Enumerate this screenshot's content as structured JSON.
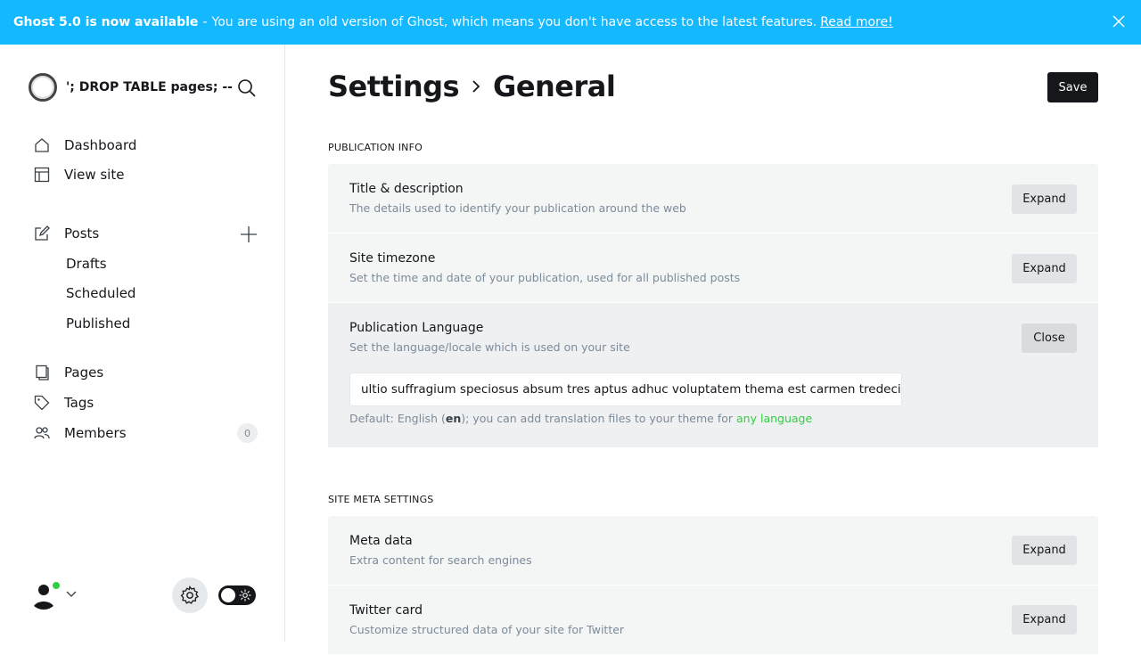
{
  "banner": {
    "bold": "Ghost 5.0 is now available",
    "separator": "-",
    "message": "You are using an old version of Ghost, which means you don't have access to the latest features.",
    "link": "Read more!"
  },
  "sidebar": {
    "site_name": "'; DROP TABLE pages; --",
    "nav": {
      "dashboard": "Dashboard",
      "view_site": "View site",
      "posts": "Posts",
      "drafts": "Drafts",
      "scheduled": "Scheduled",
      "published": "Published",
      "pages": "Pages",
      "tags": "Tags",
      "members": "Members",
      "members_count": "0"
    }
  },
  "main": {
    "breadcrumb": [
      "Settings",
      "General"
    ],
    "save_label": "Save",
    "sections": [
      {
        "title": "PUBLICATION INFO",
        "rows": [
          {
            "title": "Title & description",
            "desc": "The details used to identify your publication around the web",
            "button": "Expand"
          },
          {
            "title": "Site timezone",
            "desc": "Set the time and date of your publication, used for all published posts",
            "button": "Expand"
          },
          {
            "title": "Publication Language",
            "desc": "Set the language/locale which is used on your site",
            "button": "Close"
          }
        ]
      },
      {
        "title": "SITE META SETTINGS",
        "rows": [
          {
            "title": "Meta data",
            "desc": "Extra content for search engines",
            "button": "Expand"
          },
          {
            "title": "Twitter card",
            "desc": "Customize structured data of your site for Twitter",
            "button": "Expand"
          }
        ]
      }
    ],
    "language": {
      "value": "ultio suffragium speciosus absum tres aptus adhuc voluptatem thema est carmen tredecim",
      "hint_prefix": "Default: English (",
      "hint_code": "en",
      "hint_suffix": "); you can add translation files to your theme for",
      "hint_link": "any language"
    }
  },
  "colors": {
    "banner": "#14b8ff",
    "accent_green": "#30cf43",
    "dark": "#15171a"
  }
}
